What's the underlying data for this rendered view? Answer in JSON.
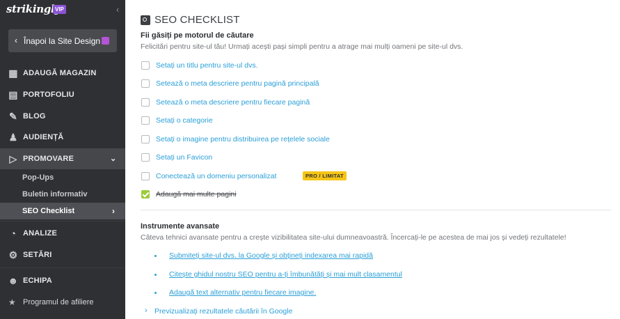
{
  "sidebar": {
    "logo": "strikingly",
    "vip_badge": "VIP",
    "collapse_icon": "chevron-left",
    "back_label": "Înapoi la Site Design",
    "nav": [
      {
        "label": "ADAUGĂ MAGAZIN",
        "icon": "store-icon"
      },
      {
        "label": "PORTOFOLIU",
        "icon": "portfolio-icon"
      },
      {
        "label": "BLOG",
        "icon": "pen-icon"
      },
      {
        "label": "AUDIENȚĂ",
        "icon": "audience-icon"
      },
      {
        "label": "PROMOVARE",
        "icon": "megaphone-icon"
      }
    ],
    "submenu": [
      "Pop-Ups",
      "Buletin informativ",
      "SEO Checklist"
    ],
    "nav2": [
      {
        "label": "ANALIZE",
        "icon": "pie-chart-icon"
      },
      {
        "label": "SETĂRI",
        "icon": "gear-icon"
      },
      {
        "label": "ECHIPA",
        "icon": "team-icon"
      }
    ],
    "affiliate": "Programul de afiliere"
  },
  "main": {
    "title": "SEO CHECKLIST",
    "section1_title": "Fii găsiți pe motorul de căutare",
    "section1_desc": "Felicitări pentru site-ul tău! Urmați acești pași simpli pentru a atrage mai mulți oameni pe site-ul dvs.",
    "checklist": [
      {
        "label": "Setați un titlu pentru site-ul dvs.",
        "checked": false
      },
      {
        "label": "Setează o meta descriere pentru pagină principală",
        "checked": false
      },
      {
        "label": "Setează o meta descriere pentru fiecare pagină",
        "checked": false
      },
      {
        "label": "Setați o categorie",
        "checked": false
      },
      {
        "label": "Setați o imagine pentru distribuirea pe rețelele sociale",
        "checked": false
      },
      {
        "label": "Setați un Favicon",
        "checked": false
      },
      {
        "label": "Conectează un domeniu personalizat",
        "checked": false,
        "badge": "PRO / LIMITAT"
      },
      {
        "label": "Adaugă mai multe pagini",
        "checked": true
      }
    ],
    "section2_title": "Instrumente avansate",
    "section2_desc": "Câteva tehnici avansate pentru a crește vizibilitatea site-ului dumneavoastră. Încercați-le pe acestea de mai jos și vedeți rezultatele!",
    "advanced_links": [
      "Submiteți site-ul dvs. la Google și obțineți indexarea mai rapidă",
      "Citește ghidul nostru SEO pentru a-ți îmbunătăți și mai mult clasamentul",
      "Adaugă text alternativ pentru fiecare imagine."
    ],
    "preview_link": "Previzualizați rezultatele căutării în Google"
  },
  "colors": {
    "sidebar_bg": "#2f3034",
    "link": "#2a9fd8",
    "badge": "#f5c518",
    "check": "#9ccc3b",
    "vip": "#8a54d6"
  }
}
